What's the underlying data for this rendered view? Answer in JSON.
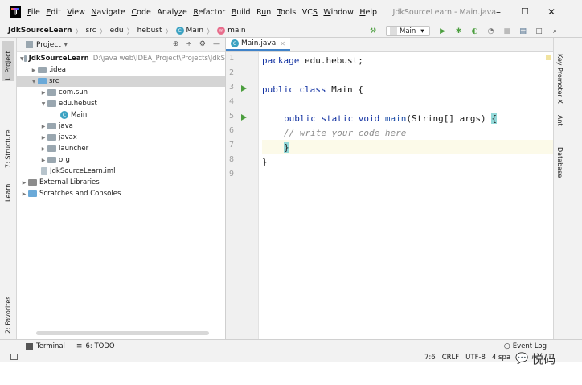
{
  "menubar": {
    "items": [
      "File",
      "Edit",
      "View",
      "Navigate",
      "Code",
      "Analyze",
      "Refactor",
      "Build",
      "Run",
      "Tools",
      "VCS",
      "Window",
      "Help"
    ],
    "mnemonics": [
      "F",
      "E",
      "V",
      "N",
      "C",
      "z",
      "R",
      "B",
      "u",
      "T",
      "S",
      "W",
      "H"
    ],
    "window_title": "JdkSourceLearn - Main.java",
    "controls": {
      "minimize": "–",
      "maximize": "☐",
      "close": "✕"
    }
  },
  "breadcrumb": {
    "items": [
      "JdkSourceLearn",
      "src",
      "edu",
      "hebust",
      "Main",
      "main"
    ]
  },
  "toolbar": {
    "run_config": "Main",
    "run_config_arrow": "▾"
  },
  "left_stripe": {
    "tabs": [
      "1: Project",
      "7: Structure",
      "Learn",
      "2: Favorites"
    ]
  },
  "right_stripe": {
    "tabs": [
      "Key Promoter X",
      "Ant",
      "Database"
    ]
  },
  "project_panel": {
    "title": "Project",
    "dropdown": "▾",
    "header_icons": [
      "⊕",
      "÷",
      "⚙",
      "—"
    ],
    "tree": [
      {
        "label": "JdkSourceLearn",
        "path": "D:\\java web\\IDEA_Project\\Projects\\JdkS",
        "arrow": "▼"
      },
      {
        "label": ".idea",
        "arrow": "▶"
      },
      {
        "label": "src",
        "arrow": "▼"
      },
      {
        "label": "com.sun",
        "arrow": "▶"
      },
      {
        "label": "edu.hebust",
        "arrow": "▼"
      },
      {
        "label": "Main",
        "arrow": ""
      },
      {
        "label": "java",
        "arrow": "▶"
      },
      {
        "label": "javax",
        "arrow": "▶"
      },
      {
        "label": "launcher",
        "arrow": "▶"
      },
      {
        "label": "org",
        "arrow": "▶"
      },
      {
        "label": "JdkSourceLearn.iml",
        "arrow": ""
      },
      {
        "label": "External Libraries",
        "arrow": "▶"
      },
      {
        "label": "Scratches and Consoles",
        "arrow": "▶"
      }
    ]
  },
  "editor": {
    "tab_label": "Main.java",
    "line_numbers": [
      "1",
      "2",
      "3",
      "4",
      "5",
      "6",
      "7",
      "8",
      "9"
    ],
    "code": {
      "l1_kw": "package",
      "l1_rest": " edu.hebust;",
      "l3_kw": "public class",
      "l3_rest": " Main {",
      "l5_kw1": "public static void",
      "l5_fn": "main",
      "l5_rest": "(String[] args) ",
      "l5_brace": "{",
      "l6_comment": "// write your code here",
      "l7_brace": "}",
      "l8_brace": "}"
    }
  },
  "bottom_tools": {
    "terminal": "Terminal",
    "todo": "6: TODO",
    "event_log": "Event Log"
  },
  "statusbar": {
    "position": "7:6",
    "line_sep": "CRLF",
    "encoding": "UTF-8",
    "indent": "4 spa",
    "watermark": "悦码"
  }
}
